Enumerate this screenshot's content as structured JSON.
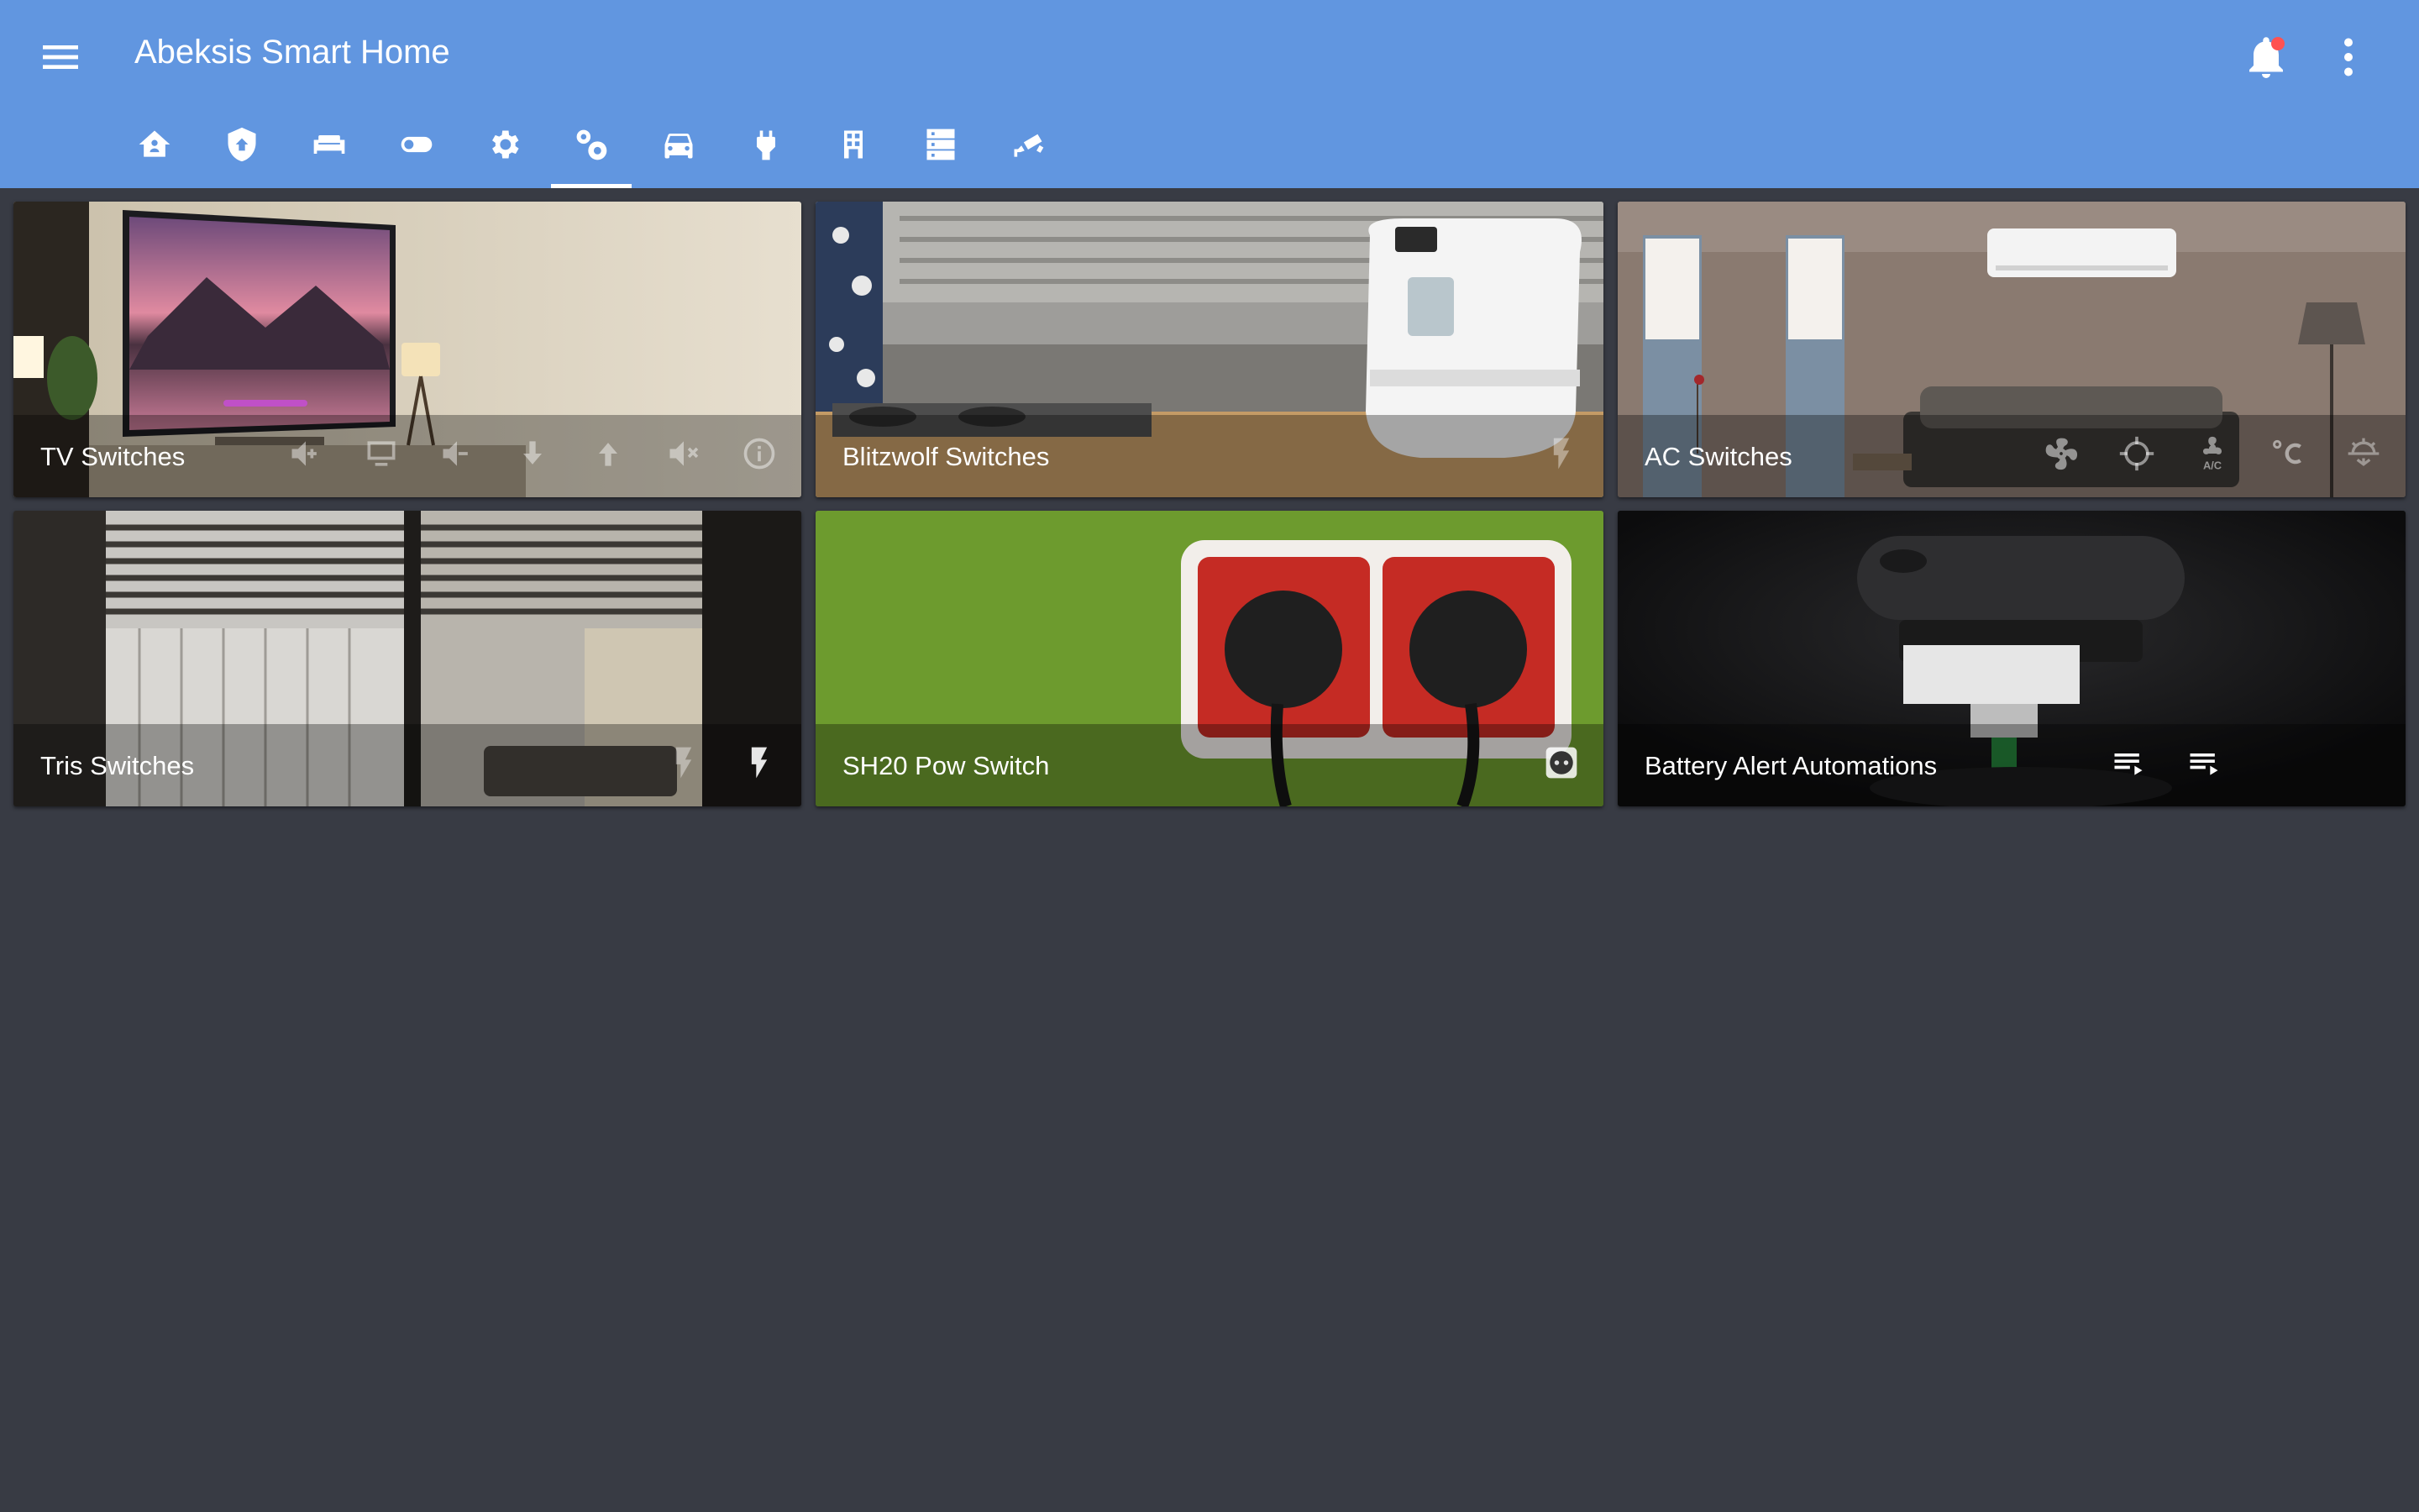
{
  "app": {
    "title": "Abeksis Smart Home"
  },
  "header_icons": {
    "menu": "menu-icon",
    "notifications": "bell-icon",
    "more": "more-vertical-icon"
  },
  "tabs": [
    {
      "icon": "home-automation-icon"
    },
    {
      "icon": "security-shield-icon"
    },
    {
      "icon": "sofa-icon"
    },
    {
      "icon": "toggle-switch-icon"
    },
    {
      "icon": "settings-gear-icon"
    },
    {
      "icon": "settings-gears-icon",
      "selected": true
    },
    {
      "icon": "car-icon"
    },
    {
      "icon": "power-plug-icon"
    },
    {
      "icon": "door-window-icon"
    },
    {
      "icon": "server-icon"
    },
    {
      "icon": "cctv-camera-icon"
    }
  ],
  "cards": [
    {
      "title": "TV Switches",
      "icons": [
        "volume-plus-icon",
        "monitor-icon",
        "volume-minus-icon",
        "arrow-down-icon",
        "arrow-up-icon",
        "volume-off-icon",
        "info-icon"
      ]
    },
    {
      "title": "Blitzwolf Switches",
      "icons": [
        "flash-icon"
      ]
    },
    {
      "title": "AC Switches",
      "icons": [
        "fan-icon",
        "crosshairs-icon",
        "air-conditioner-icon",
        "celsius-icon",
        "sun-snowflake-icon"
      ]
    },
    {
      "title": "Tris Switches",
      "icons": [
        "flash-icon",
        "flash-icon"
      ]
    },
    {
      "title": "SH20 Pow Switch",
      "icons": [
        "power-socket-icon"
      ]
    },
    {
      "title": "Battery Alert Automations",
      "icons": [
        "playlist-play-icon",
        "playlist-play-icon"
      ]
    }
  ],
  "colors": {
    "header": "#6196e0",
    "background": "#383b44",
    "notification_dot": "#ff5252",
    "text": "#ffffff"
  }
}
